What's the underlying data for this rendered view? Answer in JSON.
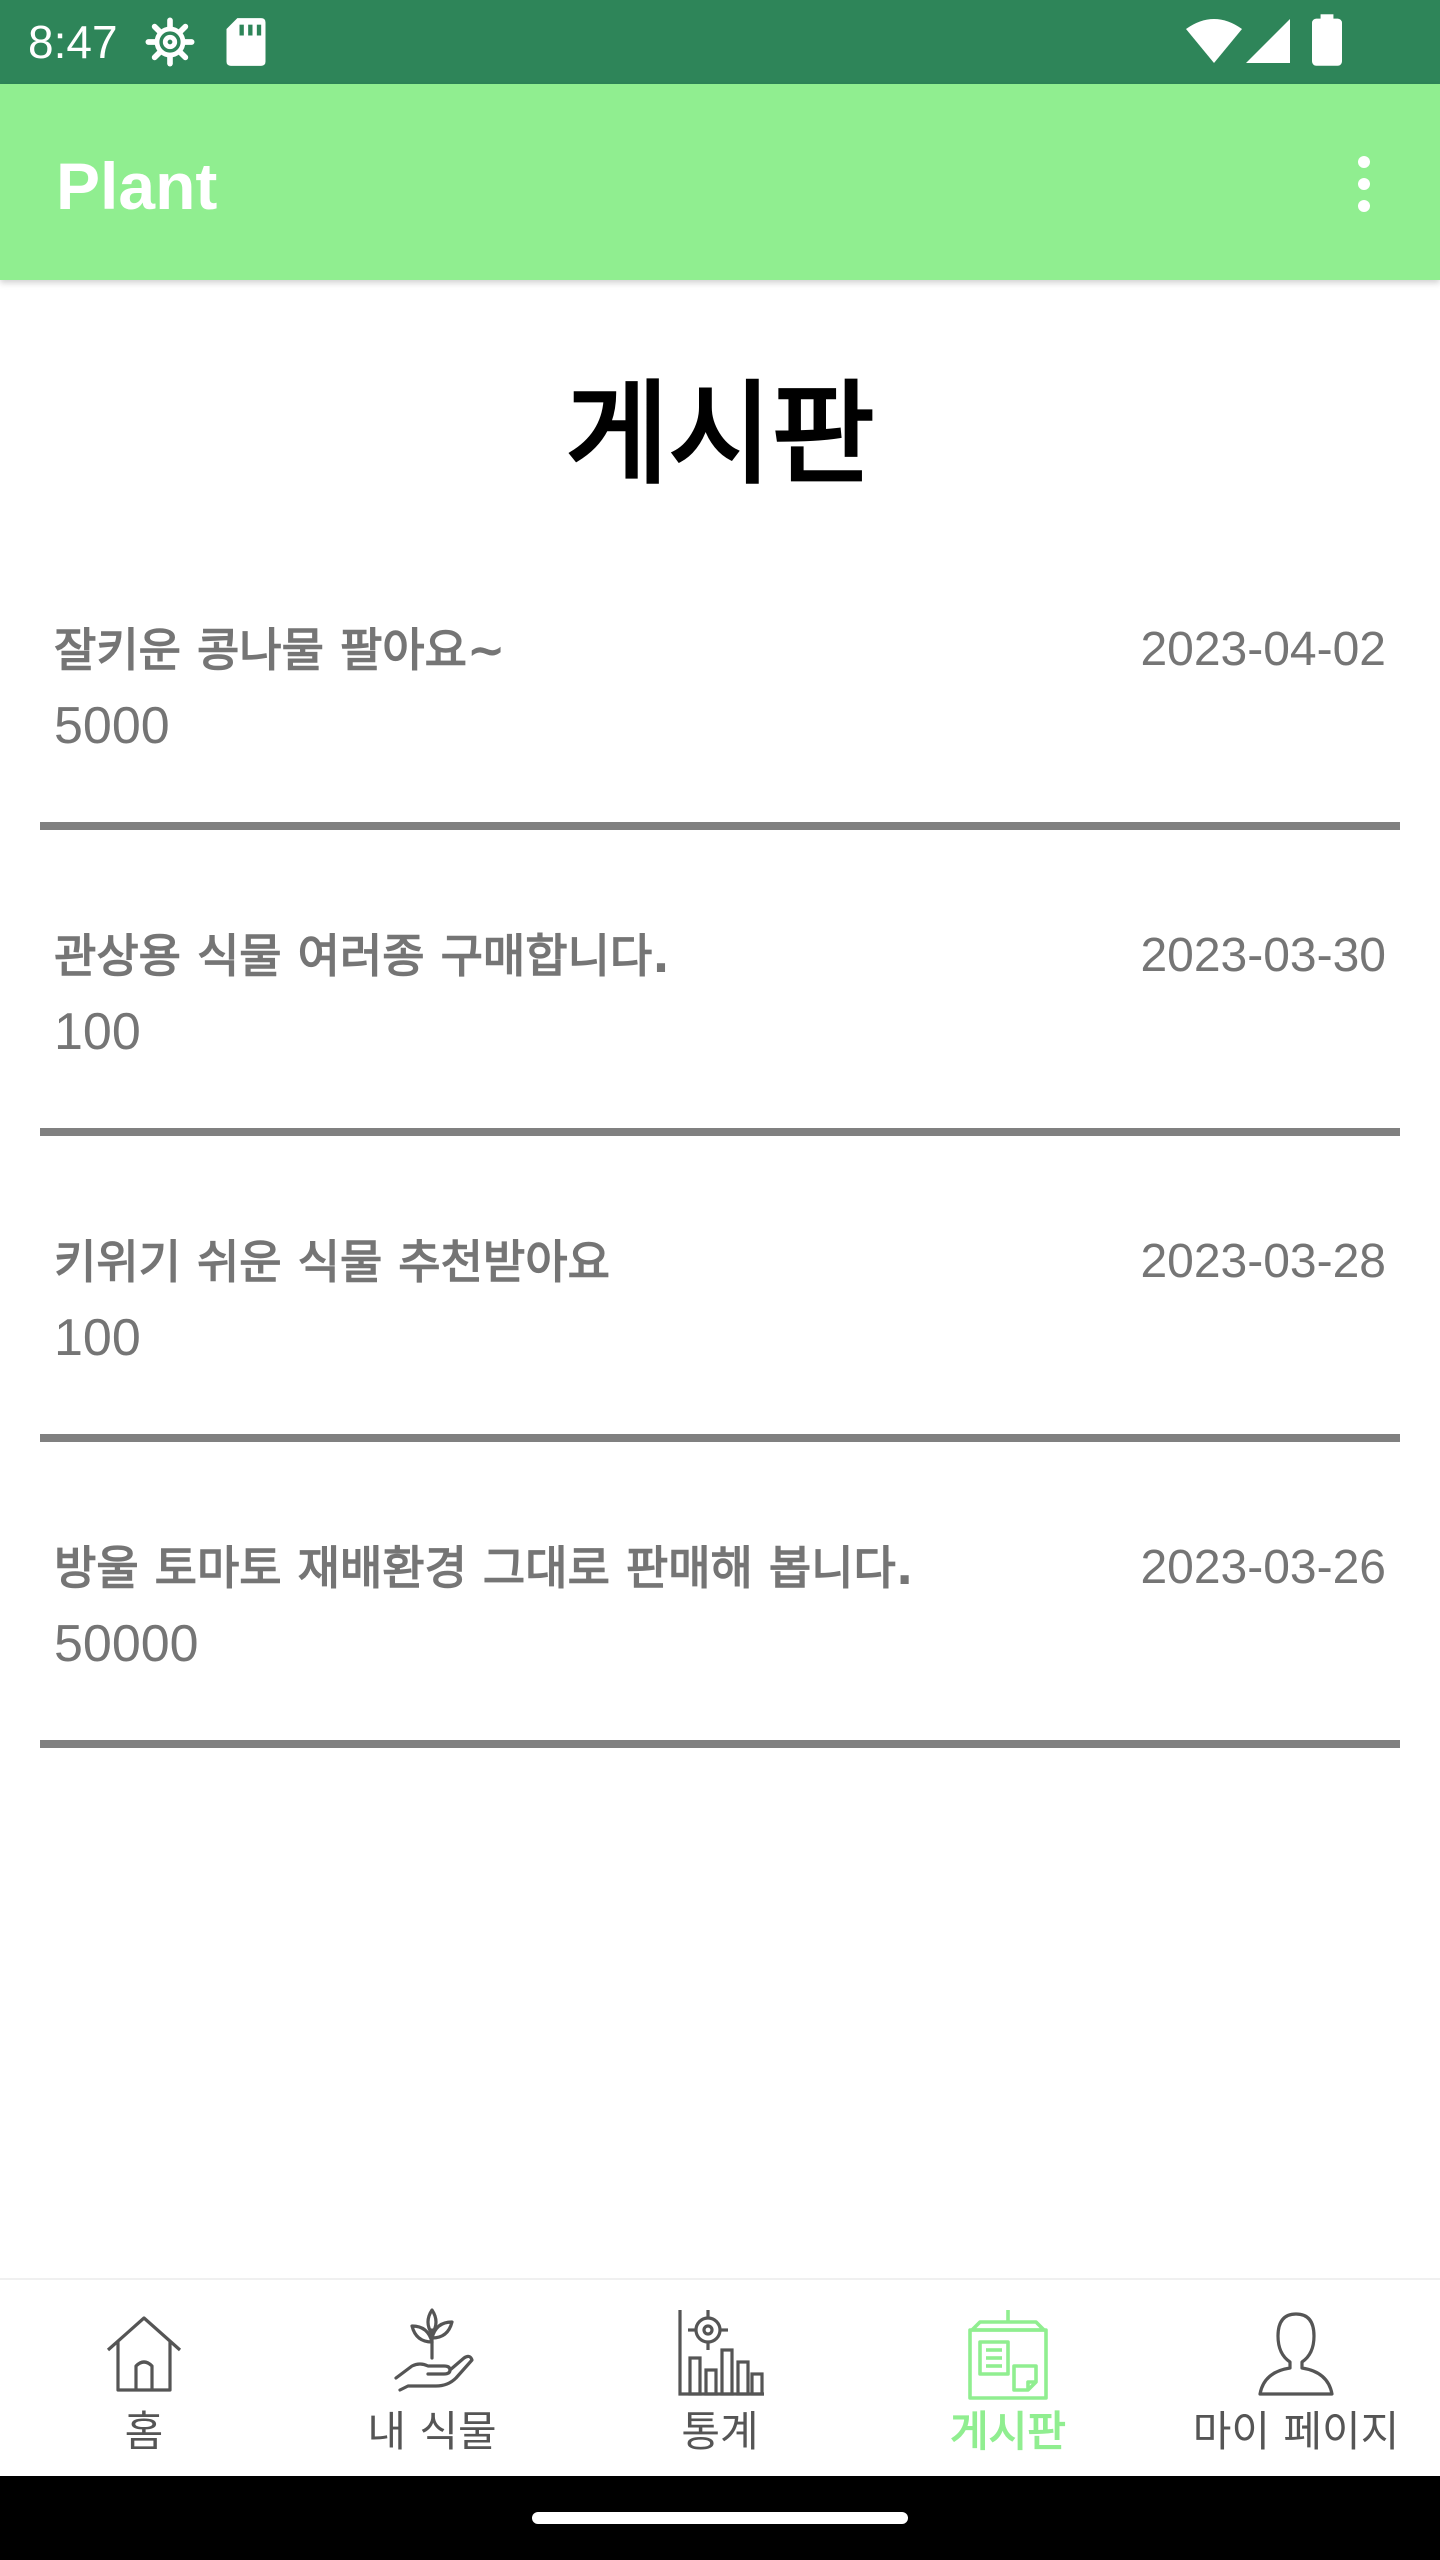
{
  "status_bar": {
    "time": "8:47",
    "left_icons": [
      "settings-icon",
      "sd-card-icon"
    ],
    "right_icons": [
      "wifi-icon",
      "signal-icon",
      "battery-icon"
    ],
    "background": "#2e8559"
  },
  "app_bar": {
    "title": "Plant",
    "menu_icon": "more-vert-icon",
    "background": "#90ee90"
  },
  "page": {
    "title": "게시판"
  },
  "posts": [
    {
      "title": "잘키운 콩나물 팔아요~",
      "price": "5000",
      "date": "2023-04-02"
    },
    {
      "title": "관상용 식물 여러종 구매합니다.",
      "price": "100",
      "date": "2023-03-30"
    },
    {
      "title": "키위기 쉬운 식물 추천받아요",
      "price": "100",
      "date": "2023-03-28"
    },
    {
      "title": "방울 토마토 재배환경 그대로 판매해 봅니다.",
      "price": "50000",
      "date": "2023-03-26"
    }
  ],
  "bottom_nav": {
    "active_color": "#90ee90",
    "items": [
      {
        "label": "홈",
        "icon": "home-icon",
        "active": false
      },
      {
        "label": "내 식물",
        "icon": "plant-hand-icon",
        "active": false
      },
      {
        "label": "통계",
        "icon": "chart-icon",
        "active": false
      },
      {
        "label": "게시판",
        "icon": "board-icon",
        "active": true
      },
      {
        "label": "마이 페이지",
        "icon": "person-icon",
        "active": false
      }
    ]
  }
}
